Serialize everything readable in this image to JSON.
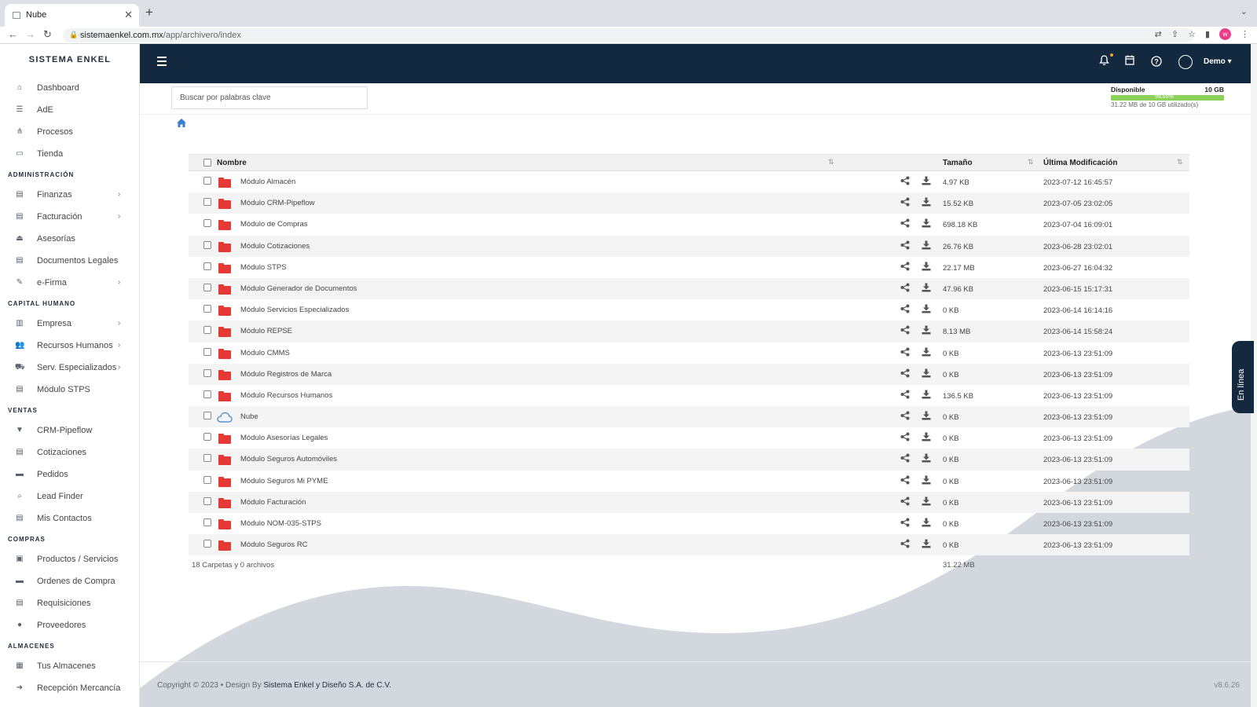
{
  "browser": {
    "tab_title": "Nube",
    "url_host": "sistemaenkel.com.mx",
    "url_path": "/app/archivero/index",
    "profile_initial": "w"
  },
  "sidebar": {
    "brand": "SISTEMA ENKEL",
    "groups": [
      {
        "section": "",
        "items": [
          {
            "label": "Dashboard",
            "icon": "home-icon"
          },
          {
            "label": "AdE",
            "icon": "list-icon"
          },
          {
            "label": "Procesos",
            "icon": "flow-icon"
          },
          {
            "label": "Tienda",
            "icon": "bag-icon"
          }
        ]
      },
      {
        "section": "ADMINISTRACIÓN",
        "items": [
          {
            "label": "Finanzas",
            "icon": "document-icon",
            "has_children": true
          },
          {
            "label": "Facturación",
            "icon": "document-icon",
            "has_children": true
          },
          {
            "label": "Asesorías",
            "icon": "eject-icon"
          },
          {
            "label": "Documentos Legales",
            "icon": "document-icon"
          },
          {
            "label": "e-Firma",
            "icon": "signature-icon",
            "has_children": true
          }
        ]
      },
      {
        "section": "CAPITAL HUMANO",
        "items": [
          {
            "label": "Empresa",
            "icon": "building-icon",
            "has_children": true
          },
          {
            "label": "Recursos Humanos",
            "icon": "users-icon",
            "has_children": true
          },
          {
            "label": "Serv. Especializados",
            "icon": "truck-icon",
            "has_children": true
          },
          {
            "label": "Módulo STPS",
            "icon": "document-icon"
          }
        ]
      },
      {
        "section": "VENTAS",
        "items": [
          {
            "label": "CRM-Pipeflow",
            "icon": "filter-icon"
          },
          {
            "label": "Cotizaciones",
            "icon": "document-icon"
          },
          {
            "label": "Pedidos",
            "icon": "card-icon"
          },
          {
            "label": "Lead Finder",
            "icon": "search-icon"
          },
          {
            "label": "Mis Contactos",
            "icon": "document-icon"
          }
        ]
      },
      {
        "section": "COMPRAS",
        "items": [
          {
            "label": "Productos / Servicios",
            "icon": "briefcase-icon"
          },
          {
            "label": "Ordenes de Compra",
            "icon": "card-icon"
          },
          {
            "label": "Requisiciones",
            "icon": "document-icon"
          },
          {
            "label": "Proveedores",
            "icon": "user-icon"
          }
        ]
      },
      {
        "section": "ALMACENES",
        "items": [
          {
            "label": "Tus Almacenes",
            "icon": "warehouse-icon"
          },
          {
            "label": "Recepción Mercancía",
            "icon": "sign-in-icon"
          }
        ]
      }
    ]
  },
  "header": {
    "user_name": "Demo"
  },
  "search": {
    "placeholder": "Buscar por palabras clave"
  },
  "storage": {
    "label": "Disponible",
    "total": "10 GB",
    "used_text": "31.22 MB de 10 GB utilizado(s)",
    "fill_pct": 100,
    "fill_label": "99.69%"
  },
  "table": {
    "col_name": "Nombre",
    "col_size": "Tamaño",
    "col_modified": "Última Modificación",
    "rows": [
      {
        "name": "Módulo Almacén",
        "size": "4.97 KB",
        "modified": "2023-07-12 16:45:57",
        "type": "folder"
      },
      {
        "name": "Módulo CRM-Pipeflow",
        "size": "15.52 KB",
        "modified": "2023-07-05 23:02:05",
        "type": "folder"
      },
      {
        "name": "Módulo de Compras",
        "size": "698.18 KB",
        "modified": "2023-07-04 16:09:01",
        "type": "folder"
      },
      {
        "name": "Módulo Cotizaciones",
        "size": "26.76 KB",
        "modified": "2023-06-28 23:02:01",
        "type": "folder"
      },
      {
        "name": "Módulo STPS",
        "size": "22.17 MB",
        "modified": "2023-06-27 16:04:32",
        "type": "folder"
      },
      {
        "name": "Módulo Generador de Documentos",
        "size": "47.96 KB",
        "modified": "2023-06-15 15:17:31",
        "type": "folder"
      },
      {
        "name": "Módulo Servicios Especializados",
        "size": "0 KB",
        "modified": "2023-06-14 16:14:16",
        "type": "folder"
      },
      {
        "name": "Módulo REPSE",
        "size": "8.13 MB",
        "modified": "2023-06-14 15:58:24",
        "type": "folder"
      },
      {
        "name": "Módulo CMMS",
        "size": "0 KB",
        "modified": "2023-06-13 23:51:09",
        "type": "folder"
      },
      {
        "name": "Módulo Registros de Marca",
        "size": "0 KB",
        "modified": "2023-06-13 23:51:09",
        "type": "folder"
      },
      {
        "name": "Módulo Recursos Humanos",
        "size": "136.5 KB",
        "modified": "2023-06-13 23:51:09",
        "type": "folder"
      },
      {
        "name": "Nube",
        "size": "0 KB",
        "modified": "2023-06-13 23:51:09",
        "type": "cloud"
      },
      {
        "name": "Módulo Asesorías Legales",
        "size": "0 KB",
        "modified": "2023-06-13 23:51:09",
        "type": "folder"
      },
      {
        "name": "Módulo Seguros Automóviles",
        "size": "0 KB",
        "modified": "2023-06-13 23:51:09",
        "type": "folder"
      },
      {
        "name": "Módulo Seguros Mi PYME",
        "size": "0 KB",
        "modified": "2023-06-13 23:51:09",
        "type": "folder"
      },
      {
        "name": "Módulo Facturación",
        "size": "0 KB",
        "modified": "2023-06-13 23:51:09",
        "type": "folder"
      },
      {
        "name": "Módulo NOM-035-STPS",
        "size": "0 KB",
        "modified": "2023-06-13 23:51:09",
        "type": "folder"
      },
      {
        "name": "Módulo Seguros RC",
        "size": "0 KB",
        "modified": "2023-06-13 23:51:09",
        "type": "folder"
      }
    ],
    "summary_count": "18 Carpetas y 0 archivos",
    "summary_size": "31.22 MB"
  },
  "footer": {
    "copyright": "Copyright © 2023 • Design By",
    "company": "Sistema Enkel y Diseño S.A. de C.V.",
    "version": "v8.6.26"
  },
  "online_tab": "En línea",
  "colors": {
    "navy": "#13293f",
    "folder_red": "#e53935",
    "storage_green": "#8bd15a",
    "wave_gray": "#d3d8df"
  }
}
